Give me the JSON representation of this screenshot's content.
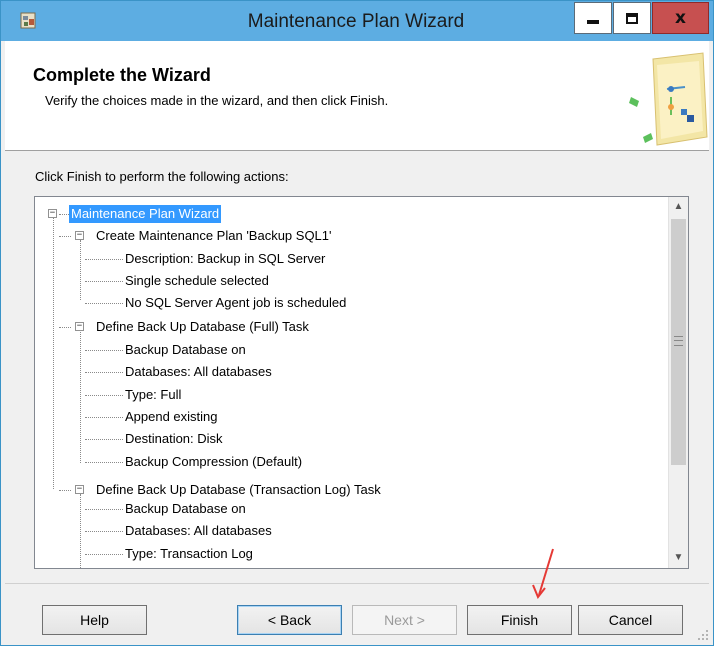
{
  "window": {
    "title": "Maintenance Plan Wizard",
    "controls": {
      "minimize_icon": "minimize-icon",
      "maximize_icon": "maximize-icon",
      "close_icon": "close-icon",
      "close_glyph": "x"
    }
  },
  "header": {
    "title": "Complete the Wizard",
    "subtitle": "Verify the choices made in the wizard, and then click Finish."
  },
  "instructions": "Click Finish to perform the following actions:",
  "tree": {
    "root": "Maintenance Plan Wizard",
    "sections": [
      {
        "label": "Create Maintenance Plan 'Backup SQL1'",
        "items": [
          "Description: Backup in SQL Server",
          "Single schedule selected",
          "No SQL Server Agent job is scheduled"
        ]
      },
      {
        "label": "Define Back Up Database (Full) Task",
        "items": [
          "Backup Database on",
          "Databases: All databases",
          "Type: Full",
          "Append existing",
          "Destination: Disk",
          "Backup Compression (Default)"
        ]
      },
      {
        "label": "Define Back Up Database (Transaction Log) Task",
        "items": [
          "Backup Database on",
          "Databases: All databases",
          "Type: Transaction Log"
        ]
      }
    ],
    "expander_glyph": "−"
  },
  "buttons": {
    "help": "Help",
    "back": "< Back",
    "next": "Next >",
    "finish": "Finish",
    "cancel": "Cancel"
  },
  "scrollbar": {
    "up_arrow": "▲",
    "down_arrow": "▼"
  },
  "colors": {
    "titlebar": "#5dade2",
    "selection": "#3399ff",
    "close_button": "#c75050",
    "annotation_arrow": "#e53935"
  }
}
